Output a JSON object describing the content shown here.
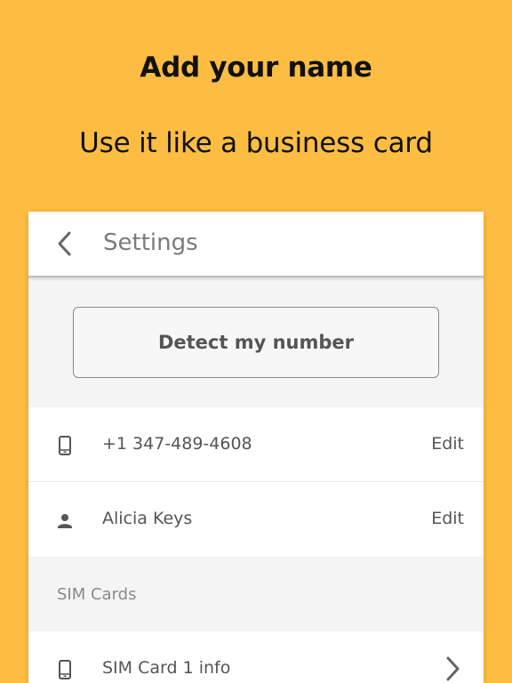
{
  "promo": {
    "headline": "Add your name",
    "subline": "Use it like a business card"
  },
  "colors": {
    "background": "#fdbd43",
    "surface": "#ffffff",
    "section": "#f4f4f4",
    "text": "#555555"
  },
  "appbar": {
    "title": "Settings",
    "back_icon": "chevron-left-icon"
  },
  "detect": {
    "button_label": "Detect my number"
  },
  "rows": {
    "phone": {
      "icon": "smartphone-icon",
      "label": "+1 347-489-4608",
      "action": "Edit"
    },
    "name": {
      "icon": "person-icon",
      "label": "Alicia Keys",
      "action": "Edit"
    }
  },
  "sim_section": {
    "header": "SIM Cards",
    "items": [
      {
        "icon": "smartphone-icon",
        "label": "SIM Card 1 info",
        "trailing_icon": "chevron-right-icon"
      }
    ]
  }
}
